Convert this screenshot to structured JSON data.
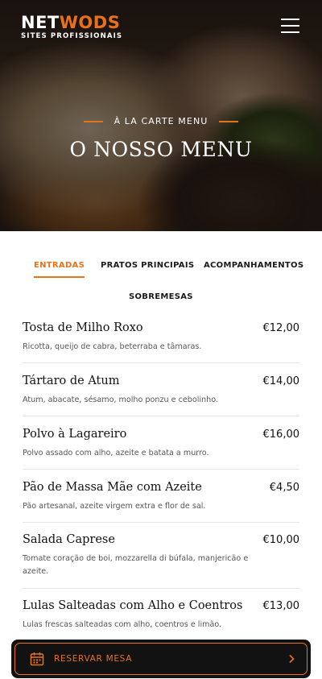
{
  "brand": {
    "name_part1": "NET",
    "name_part2": "WODS",
    "tagline": "SITES PROFISSIONAIS",
    "accent_color": "#e8721c"
  },
  "header": {
    "menu_icon": "hamburger-icon"
  },
  "hero": {
    "eyebrow": "À LA CARTE MENU",
    "title": "O NOSSO MENU"
  },
  "tabs": [
    {
      "label": "ENTRADAS",
      "active": true
    },
    {
      "label": "PRATOS PRINCIPAIS",
      "active": false
    },
    {
      "label": "ACOMPANHAMENTOS",
      "active": false
    },
    {
      "label": "SOBREMESAS",
      "active": false
    }
  ],
  "menu_items": [
    {
      "name": "Tosta de Milho Roxo",
      "price": "€12,00",
      "desc": "Ricotta, queijo de cabra, beterraba e tâmaras."
    },
    {
      "name": "Tártaro de Atum",
      "price": "€14,00",
      "desc": "Atum, abacate, sésamo, molho ponzu e cebolinho."
    },
    {
      "name": "Polvo à Lagareiro",
      "price": "€16,00",
      "desc": "Polvo assado com alho, azeite e batata a murro."
    },
    {
      "name": "Pão de Massa Mãe com Azeite",
      "price": "€4,50",
      "desc": "Pão artesanal, azeite virgem extra e flor de sal."
    },
    {
      "name": "Salada Caprese",
      "price": "€10,00",
      "desc": "Tomate coração de boi, mozzarella di búfala, manjericão e azeite."
    },
    {
      "name": "Lulas Salteadas com Alho e Coentros",
      "price": "€13,00",
      "desc": "Lulas frescas salteadas com alho, coentros e limão."
    }
  ],
  "reserve": {
    "label": "RESERVAR MESA",
    "icon": "calendar-icon",
    "chevron": "chevron-right-icon"
  }
}
